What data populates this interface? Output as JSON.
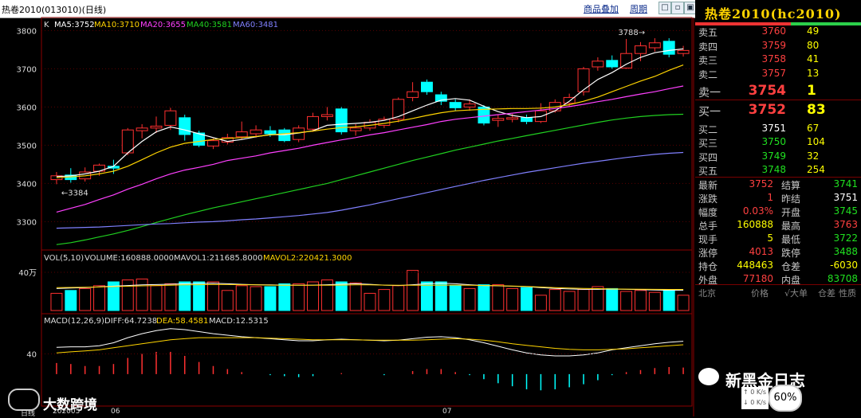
{
  "window": {
    "title": "热卷2010(013010)(日线)",
    "menu_overlay": "商品叠加",
    "menu_period": "周期",
    "win_buttons": [
      "□",
      "▫",
      "▣",
      "✕"
    ]
  },
  "main": {
    "k_label": "K",
    "ma_labels": [
      {
        "text": "MA5:3752",
        "color": "#ffffff"
      },
      {
        "text": "MA10:3710",
        "color": "#ffd400"
      },
      {
        "text": "MA20:3655",
        "color": "#ff40ff"
      },
      {
        "text": "MA40:3581",
        "color": "#20d020"
      },
      {
        "text": "MA60:3481",
        "color": "#8080ff"
      }
    ],
    "high_marker": "3788→",
    "low_marker": "←3384"
  },
  "volume": {
    "label_prefix": "VOL(5,10)",
    "volume": "VOLUME:160888.0000",
    "mavol1": "MAVOL1:211685.8000",
    "mavol2": "MAVOL2:220421.3000",
    "y_tick": "40万"
  },
  "macd": {
    "label_prefix": "MACD(12,26,9)",
    "diff": "DIFF:64.7238",
    "dea": "DEA:58.4581",
    "macd": "MACD:12.5315",
    "y_tick": "40"
  },
  "time_axis": {
    "left_tab": "日线",
    "ticks": [
      "202005",
      "06",
      "07"
    ]
  },
  "chart_data": {
    "type": "candlestick",
    "y_ticks": [
      3300,
      3400,
      3500,
      3600,
      3700,
      3800
    ],
    "ylim": [
      3230,
      3830
    ],
    "candles": [
      [
        3410,
        3420,
        3430,
        3398
      ],
      [
        3422,
        3410,
        3440,
        3402
      ],
      [
        3412,
        3430,
        3442,
        3405
      ],
      [
        3432,
        3448,
        3452,
        3420
      ],
      [
        3445,
        3440,
        3462,
        3425
      ],
      [
        3480,
        3540,
        3545,
        3474
      ],
      [
        3538,
        3545,
        3555,
        3518
      ],
      [
        3545,
        3550,
        3575,
        3532
      ],
      [
        3552,
        3590,
        3598,
        3540
      ],
      [
        3572,
        3528,
        3580,
        3512
      ],
      [
        3532,
        3500,
        3538,
        3495
      ],
      [
        3498,
        3512,
        3518,
        3490
      ],
      [
        3508,
        3520,
        3530,
        3502
      ],
      [
        3522,
        3535,
        3562,
        3515
      ],
      [
        3530,
        3540,
        3552,
        3520
      ],
      [
        3538,
        3530,
        3550,
        3522
      ],
      [
        3540,
        3512,
        3545,
        3508
      ],
      [
        3515,
        3545,
        3552,
        3508
      ],
      [
        3542,
        3575,
        3585,
        3535
      ],
      [
        3575,
        3580,
        3600,
        3565
      ],
      [
        3595,
        3535,
        3600,
        3528
      ],
      [
        3538,
        3545,
        3555,
        3525
      ],
      [
        3545,
        3560,
        3568,
        3538
      ],
      [
        3552,
        3568,
        3575,
        3545
      ],
      [
        3568,
        3620,
        3625,
        3560
      ],
      [
        3625,
        3640,
        3665,
        3615
      ],
      [
        3665,
        3640,
        3672,
        3632
      ],
      [
        3632,
        3615,
        3640,
        3605
      ],
      [
        3612,
        3598,
        3620,
        3590
      ],
      [
        3600,
        3608,
        3620,
        3590
      ],
      [
        3600,
        3558,
        3605,
        3552
      ],
      [
        3565,
        3570,
        3580,
        3548
      ],
      [
        3568,
        3572,
        3582,
        3560
      ],
      [
        3572,
        3562,
        3580,
        3555
      ],
      [
        3562,
        3590,
        3610,
        3558
      ],
      [
        3590,
        3612,
        3620,
        3585
      ],
      [
        3610,
        3625,
        3635,
        3600
      ],
      [
        3640,
        3700,
        3705,
        3630
      ],
      [
        3705,
        3720,
        3730,
        3695
      ],
      [
        3722,
        3705,
        3735,
        3700
      ],
      [
        3702,
        3740,
        3778,
        3700
      ],
      [
        3740,
        3760,
        3770,
        3720
      ],
      [
        3755,
        3768,
        3780,
        3745
      ],
      [
        3772,
        3738,
        3780,
        3730
      ],
      [
        3740,
        3748,
        3760,
        3732
      ]
    ],
    "ma5": [
      3418,
      3420,
      3425,
      3432,
      3445,
      3480,
      3510,
      3535,
      3548,
      3540,
      3530,
      3520,
      3510,
      3515,
      3522,
      3528,
      3527,
      3532,
      3538,
      3552,
      3555,
      3557,
      3560,
      3565,
      3575,
      3590,
      3605,
      3618,
      3622,
      3618,
      3602,
      3588,
      3578,
      3572,
      3575,
      3590,
      3615,
      3645,
      3672,
      3690,
      3712,
      3730,
      3742,
      3748,
      3752
    ],
    "ma10": [
      3415,
      3417,
      3420,
      3425,
      3432,
      3445,
      3462,
      3480,
      3495,
      3505,
      3510,
      3515,
      3518,
      3520,
      3523,
      3527,
      3530,
      3533,
      3537,
      3542,
      3546,
      3548,
      3552,
      3557,
      3563,
      3570,
      3578,
      3585,
      3590,
      3592,
      3594,
      3595,
      3596,
      3596,
      3597,
      3600,
      3606,
      3615,
      3626,
      3640,
      3654,
      3668,
      3680,
      3696,
      3710
    ],
    "ma20": [
      3325,
      3335,
      3345,
      3358,
      3370,
      3385,
      3398,
      3412,
      3425,
      3435,
      3442,
      3450,
      3460,
      3466,
      3472,
      3480,
      3486,
      3492,
      3500,
      3507,
      3514,
      3520,
      3527,
      3533,
      3540,
      3547,
      3554,
      3562,
      3568,
      3572,
      3576,
      3580,
      3584,
      3588,
      3592,
      3596,
      3601,
      3607,
      3614,
      3620,
      3627,
      3634,
      3640,
      3648,
      3655
    ],
    "ma40": [
      3240,
      3245,
      3252,
      3260,
      3268,
      3277,
      3287,
      3298,
      3308,
      3318,
      3327,
      3336,
      3344,
      3352,
      3360,
      3368,
      3376,
      3384,
      3392,
      3400,
      3410,
      3420,
      3430,
      3440,
      3450,
      3460,
      3469,
      3478,
      3487,
      3495,
      3503,
      3511,
      3518,
      3525,
      3532,
      3539,
      3546,
      3553,
      3560,
      3566,
      3571,
      3575,
      3578,
      3580,
      3581
    ],
    "ma60": [
      3283,
      3284,
      3285,
      3286,
      3288,
      3290,
      3292,
      3294,
      3295,
      3297,
      3299,
      3300,
      3302,
      3305,
      3307,
      3310,
      3313,
      3316,
      3320,
      3324,
      3330,
      3337,
      3344,
      3352,
      3360,
      3368,
      3376,
      3384,
      3392,
      3400,
      3408,
      3415,
      3422,
      3429,
      3435,
      3441,
      3447,
      3453,
      3458,
      3463,
      3468,
      3472,
      3476,
      3479,
      3481
    ],
    "vol_ylim": [
      0,
      600000
    ],
    "volume": [
      180000,
      210000,
      230000,
      260000,
      300000,
      320000,
      330000,
      260000,
      280000,
      300000,
      300000,
      300000,
      210000,
      260000,
      250000,
      250000,
      280000,
      280000,
      300000,
      320000,
      300000,
      290000,
      180000,
      220000,
      260000,
      420000,
      300000,
      300000,
      260000,
      230000,
      270000,
      270000,
      230000,
      240000,
      160000,
      220000,
      200000,
      220000,
      250000,
      230000,
      200000,
      210000,
      190000,
      220000,
      160000
    ],
    "mavol1": [
      230000,
      235000,
      240000,
      248000,
      255000,
      262000,
      268000,
      272000,
      275000,
      280000,
      284000,
      286000,
      280000,
      274000,
      270000,
      268000,
      266000,
      264000,
      266000,
      270000,
      276000,
      280000,
      274000,
      266000,
      262000,
      270000,
      280000,
      286000,
      280000,
      270000,
      262000,
      258000,
      254000,
      250000,
      240000,
      232000,
      226000,
      222000,
      222000,
      224000,
      222000,
      218000,
      214000,
      212000,
      211686
    ],
    "mavol2": [
      240000,
      242000,
      244000,
      246000,
      250000,
      254000,
      258000,
      262000,
      265000,
      268000,
      270000,
      272000,
      272000,
      270000,
      268000,
      266000,
      265000,
      264000,
      264000,
      265000,
      266000,
      268000,
      268000,
      266000,
      264000,
      264000,
      265000,
      266000,
      266000,
      264000,
      262000,
      260000,
      256000,
      252000,
      246000,
      240000,
      236000,
      232000,
      229000,
      226000,
      224000,
      223000,
      222000,
      221000,
      220421
    ],
    "macd_ylim": [
      -60,
      110
    ],
    "diff": [
      53,
      54,
      54,
      56,
      62,
      72,
      80,
      86,
      90,
      88,
      84,
      80,
      77,
      74,
      72,
      70,
      68,
      66,
      66,
      68,
      69,
      68,
      67,
      66,
      67,
      70,
      73,
      74,
      72,
      68,
      62,
      55,
      48,
      42,
      38,
      36,
      36,
      38,
      42,
      48,
      52,
      56,
      60,
      63,
      65
    ],
    "dea": [
      42,
      44,
      46,
      48,
      52,
      56,
      60,
      64,
      68,
      70,
      72,
      72,
      72,
      72,
      72,
      71,
      70,
      69,
      68,
      68,
      68,
      68,
      67,
      67,
      67,
      67,
      68,
      69,
      70,
      69,
      67,
      64,
      60,
      57,
      54,
      51,
      49,
      48,
      48,
      49,
      50,
      52,
      54,
      56,
      58
    ],
    "macd_bar": [
      22,
      20,
      16,
      16,
      20,
      32,
      40,
      44,
      44,
      36,
      24,
      16,
      10,
      4,
      0,
      -2,
      -4,
      -6,
      -4,
      0,
      2,
      0,
      0,
      -2,
      0,
      6,
      10,
      10,
      4,
      -2,
      -10,
      -18,
      -24,
      -30,
      -32,
      -30,
      -26,
      -20,
      -12,
      -2,
      4,
      8,
      12,
      14,
      13
    ]
  },
  "quote": {
    "title": "热卷2010(hc2010)",
    "asks": [
      {
        "label": "卖五",
        "price": "3760",
        "vol": "49"
      },
      {
        "label": "卖四",
        "price": "3759",
        "vol": "80"
      },
      {
        "label": "卖三",
        "price": "3758",
        "vol": "41"
      },
      {
        "label": "卖二",
        "price": "3757",
        "vol": "13"
      },
      {
        "label": "卖一",
        "price": "3754",
        "vol": "1"
      }
    ],
    "bids": [
      {
        "label": "买一",
        "price": "3752",
        "vol": "83"
      },
      {
        "label": "买二",
        "price": "3751",
        "vol": "67"
      },
      {
        "label": "买三",
        "price": "3750",
        "vol": "104"
      },
      {
        "label": "买四",
        "price": "3749",
        "vol": "32"
      },
      {
        "label": "买五",
        "price": "3748",
        "vol": "254"
      }
    ],
    "stats": [
      {
        "l1": "最新",
        "v1": "3752",
        "c1": "#ff4040",
        "l2": "结算",
        "v2": "3741",
        "c2": "#20e020"
      },
      {
        "l1": "涨跌",
        "v1": "1",
        "c1": "#ff4040",
        "l2": "昨结",
        "v2": "3751",
        "c2": "#ffffff"
      },
      {
        "l1": "幅度",
        "v1": "0.03%",
        "c1": "#ff4040",
        "l2": "开盘",
        "v2": "3745",
        "c2": "#20e020"
      },
      {
        "l1": "总手",
        "v1": "160888",
        "c1": "#ffff00",
        "l2": "最高",
        "v2": "3763",
        "c2": "#ff4040"
      },
      {
        "l1": "现手",
        "v1": "5",
        "c1": "#ffff00",
        "l2": "最低",
        "v2": "3722",
        "c2": "#20e020"
      },
      {
        "l1": "涨停",
        "v1": "4013",
        "c1": "#ff4040",
        "l2": "跌停",
        "v2": "3488",
        "c2": "#20e020"
      },
      {
        "l1": "持仓",
        "v1": "448463",
        "c1": "#ffff00",
        "l2": "仓差",
        "v2": "-6030",
        "c2": "#ffff00"
      },
      {
        "l1": "外盘",
        "v1": "77180",
        "c1": "#ff4040",
        "l2": "内盘",
        "v2": "83708",
        "c2": "#20e020"
      }
    ],
    "footer": {
      "c1": "北京",
      "c2": "价格",
      "c3": "√大单",
      "c4": "仓差",
      "c5": "性质"
    }
  },
  "overlay": {
    "watermark_left": "大数跨境",
    "watermark_right": "新黑金日志",
    "badge": "60%",
    "net_up": "0 K/s",
    "net_down": "0 K/s"
  }
}
